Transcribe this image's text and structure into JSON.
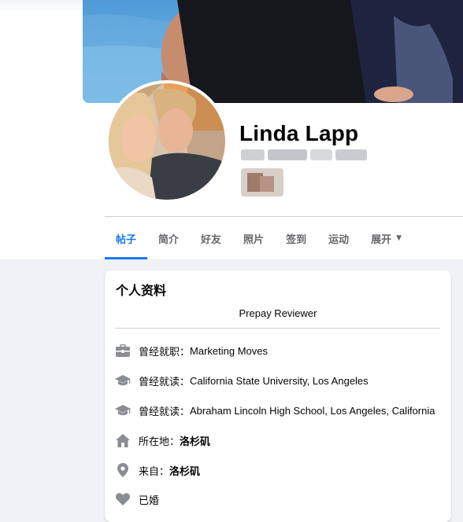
{
  "profile": {
    "name": "Linda Lapp"
  },
  "tabs": [
    {
      "label": "帖子"
    },
    {
      "label": "简介"
    },
    {
      "label": "好友"
    },
    {
      "label": "照片"
    },
    {
      "label": "签到"
    },
    {
      "label": "运动"
    },
    {
      "label": "展开"
    }
  ],
  "intro": {
    "title": "个人资料",
    "bio": "Prepay Reviewer",
    "rows": [
      {
        "icon": "briefcase-icon",
        "label": "曾经就职：",
        "value": "Marketing Moves"
      },
      {
        "icon": "graduation-cap-icon",
        "label": "曾经就读：",
        "value": "California State University, Los Angeles"
      },
      {
        "icon": "graduation-cap-icon",
        "label": "曾经就读：",
        "value": "Abraham Lincoln High School, Los Angeles, California"
      },
      {
        "icon": "home-icon",
        "label": "所在地：",
        "value": "洛杉矶"
      },
      {
        "icon": "location-pin-icon",
        "label": "来自：",
        "value": "洛杉矶"
      },
      {
        "icon": "heart-icon",
        "label": "已婚",
        "value": ""
      }
    ]
  },
  "colors": {
    "accent": "#1877f2",
    "icon_gray": "#8a8d91",
    "text_secondary": "#65676b"
  }
}
